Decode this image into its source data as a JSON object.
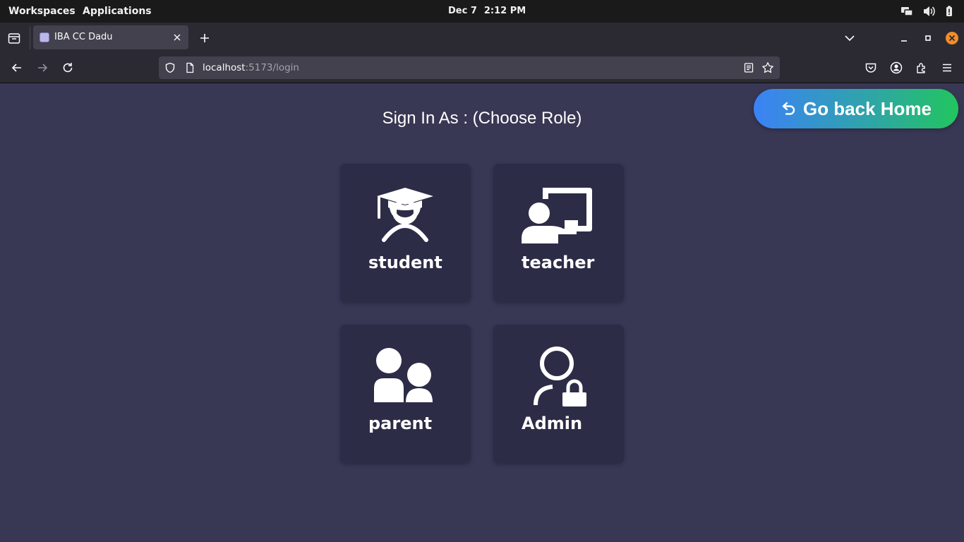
{
  "system_bar": {
    "workspaces": "Workspaces",
    "applications": "Applications",
    "date": "Dec 7",
    "time": "2:12 PM"
  },
  "browser": {
    "tab": {
      "title": "IBA CC Dadu"
    },
    "url": {
      "host": "localhost",
      "path": ":5173/login"
    }
  },
  "page": {
    "title": "Sign In As : (Choose Role)",
    "home_button_label": "Go back Home",
    "roles": [
      {
        "label": "student",
        "icon": "graduation-cap-user-icon"
      },
      {
        "label": "teacher",
        "icon": "chalkboard-teacher-icon"
      },
      {
        "label": "parent",
        "icon": "user-group-icon"
      },
      {
        "label": "Admin",
        "icon": "user-lock-icon"
      }
    ]
  },
  "colors": {
    "page_background": "#383754",
    "card_background": "#2d2c47",
    "button_gradient_start": "#3b82f6",
    "button_gradient_end": "#22c55e"
  }
}
